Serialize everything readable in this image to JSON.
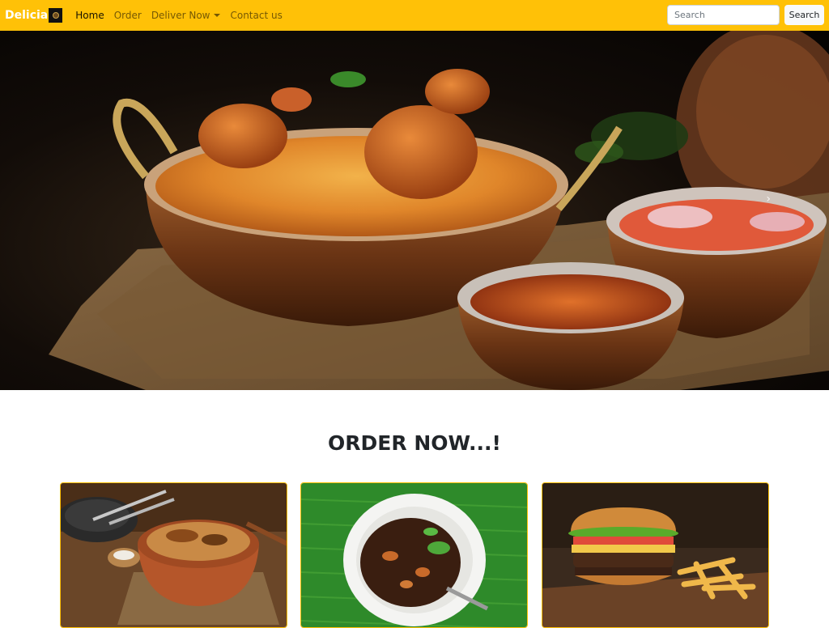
{
  "nav": {
    "brand": "Delicia",
    "links": [
      {
        "label": "Home",
        "active": true
      },
      {
        "label": "Order",
        "active": false
      },
      {
        "label": "Deliver Now",
        "active": false,
        "dropdown": true
      },
      {
        "label": "Contact us",
        "active": false
      }
    ]
  },
  "search": {
    "placeholder": "Search",
    "button_label": "Search"
  },
  "hero": {
    "image": "biryani-hero-image",
    "next_icon": "chevron-right-icon"
  },
  "section": {
    "title": "ORDER NOW...!"
  },
  "cards": [
    {
      "image": "biryani-clay-pot-image"
    },
    {
      "image": "beef-fry-banana-leaf-image"
    },
    {
      "image": "burger-fries-image"
    }
  ],
  "colors": {
    "navbar": "#ffc107",
    "card_border": "#ffc107",
    "brand_text": "#ffffff"
  }
}
